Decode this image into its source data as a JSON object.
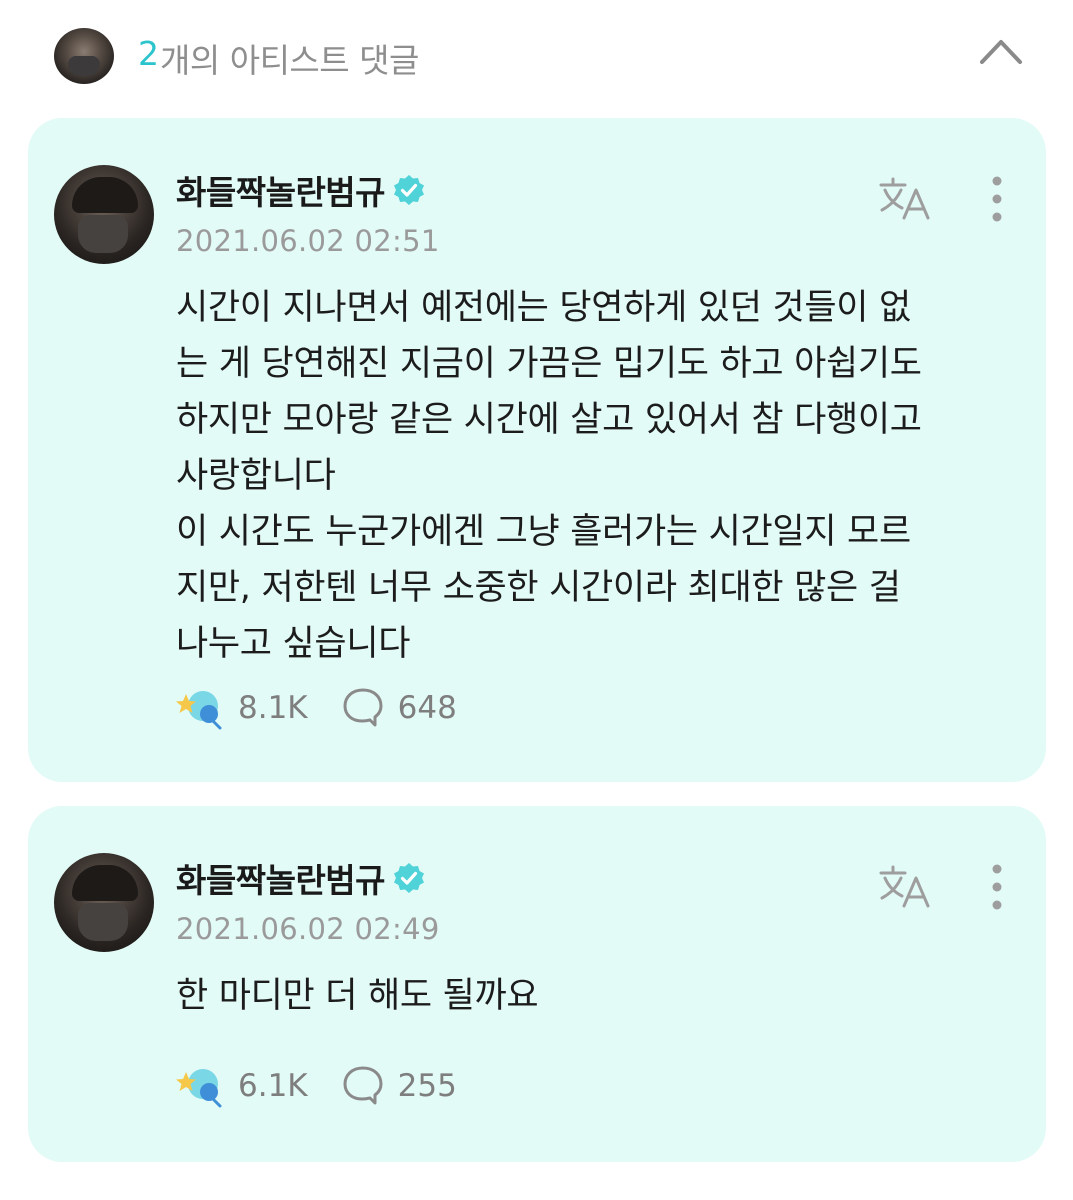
{
  "header": {
    "count": "2",
    "title": "개의 아티스트 댓글"
  },
  "comments": [
    {
      "author": "화들짝놀란범규",
      "timestamp": "2021.06.02 02:51",
      "body": "시간이 지나면서 예전에는 당연하게 있던 것들이 없\n는 게 당연해진 지금이 가끔은 밉기도 하고 아쉽기도\n하지만 모아랑 같은 시간에 살고 있어서 참 다행이고\n사랑합니다\n이 시간도 누군가에겐 그냥 흘러가는 시간일지 모르\n지만, 저한텐 너무 소중한 시간이라 최대한 많은 걸\n나누고 싶습니다",
      "cheers": "8.1K",
      "replies": "648"
    },
    {
      "author": "화들짝놀란범규",
      "timestamp": "2021.06.02 02:49",
      "body": "한 마디만 더 해도 될까요",
      "cheers": "6.1K",
      "replies": "255"
    }
  ],
  "icons": {
    "collapse": "chevron-up-icon",
    "verified": "verified-badge-icon",
    "translate": "translate-icon",
    "more": "more-vertical-icon",
    "cheer": "cheer-icon",
    "reply": "reply-bubble-icon"
  },
  "colors": {
    "accent": "#2bc4cc",
    "card_background": "#e3fbf7",
    "verified": "#4fd2d8",
    "muted_text": "#9a9a9a"
  }
}
